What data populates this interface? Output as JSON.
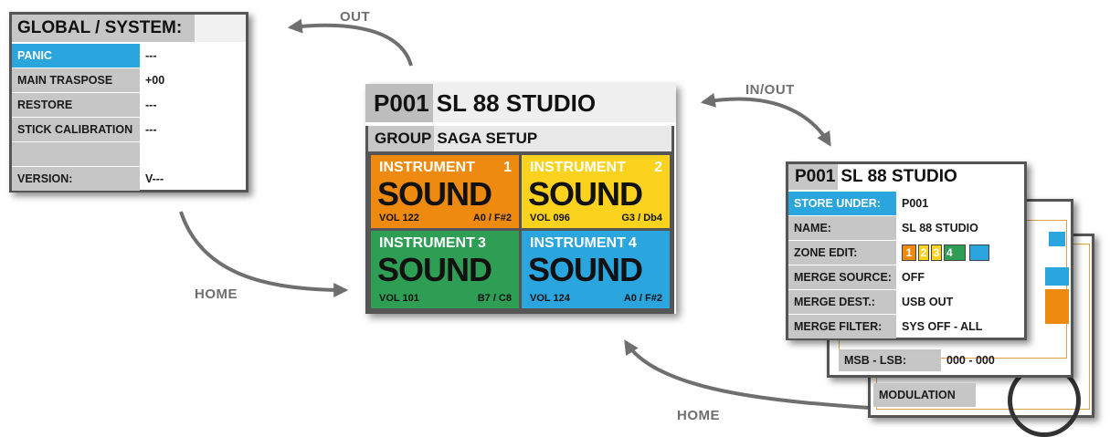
{
  "colors": {
    "highlight": "#2aa5de",
    "orange": "#ef8a10",
    "yellow": "#fbd21e",
    "green": "#2e9e55",
    "blue": "#2aa5de",
    "gray_label": "#c6c6c6",
    "arrow": "#6f6f6f"
  },
  "flow_labels": {
    "out": "OUT",
    "in_out": "IN/OUT",
    "home_left": "HOME",
    "home_bottom": "HOME"
  },
  "global_panel": {
    "title": "GLOBAL / SYSTEM:",
    "rows": [
      {
        "label": "PANIC",
        "value": "---"
      },
      {
        "label": "MAIN TRASPOSE",
        "value": "+00"
      },
      {
        "label": "RESTORE",
        "value": "---"
      },
      {
        "label": "STICK CALIBRATION",
        "value": "---"
      },
      {
        "label": "",
        "value": ""
      },
      {
        "label": "VERSION:",
        "value": "V---"
      }
    ]
  },
  "main_panel": {
    "preset_num": "P001",
    "preset_name": "SL 88 STUDIO",
    "group_label": "GROUP",
    "group_name": "SAGA SETUP",
    "instruments": [
      {
        "label": "INSTRUMENT",
        "number": "1",
        "sound": "SOUND",
        "vol": "VOL 122",
        "range": "A0 / F#2",
        "color": "#ef8a10"
      },
      {
        "label": "INSTRUMENT",
        "number": "2",
        "sound": "SOUND",
        "vol": "VOL 096",
        "range": "G3 / Db4",
        "color": "#fbd21e"
      },
      {
        "label": "INSTRUMENT",
        "number": "3",
        "sound": "SOUND",
        "vol": "VOL 101",
        "range": "B7 / C8",
        "color": "#2e9e55"
      },
      {
        "label": "INSTRUMENT",
        "number": "4",
        "sound": "SOUND",
        "vol": "VOL 124",
        "range": "A0 / F#2",
        "color": "#2aa5de"
      }
    ]
  },
  "preset_panel": {
    "preset_num": "P001",
    "preset_name": "SL 88 STUDIO",
    "rows": [
      {
        "label": "STORE UNDER:",
        "value": "P001"
      },
      {
        "label": "NAME:",
        "value": "SL 88 STUDIO"
      },
      {
        "label": "ZONE EDIT:",
        "value": ""
      },
      {
        "label": "MERGE SOURCE:",
        "value": "OFF"
      },
      {
        "label": "MERGE DEST.:",
        "value": "USB OUT"
      },
      {
        "label": "MERGE FILTER:",
        "value": "SYS OFF - ALL"
      }
    ],
    "zones": [
      {
        "text": "1",
        "color": "#ef8a10"
      },
      {
        "text": "2",
        "color": "#fbd21e"
      },
      {
        "text": "3",
        "color": "#fbd21e"
      },
      {
        "text": "4",
        "color": "#2e9e55"
      },
      {
        "text": "",
        "color": "#2aa5de"
      }
    ]
  },
  "back_panel": {
    "msb_label": "MSB - LSB:",
    "msb_value": "000 - 000",
    "modulation_label": "MODULATION"
  }
}
